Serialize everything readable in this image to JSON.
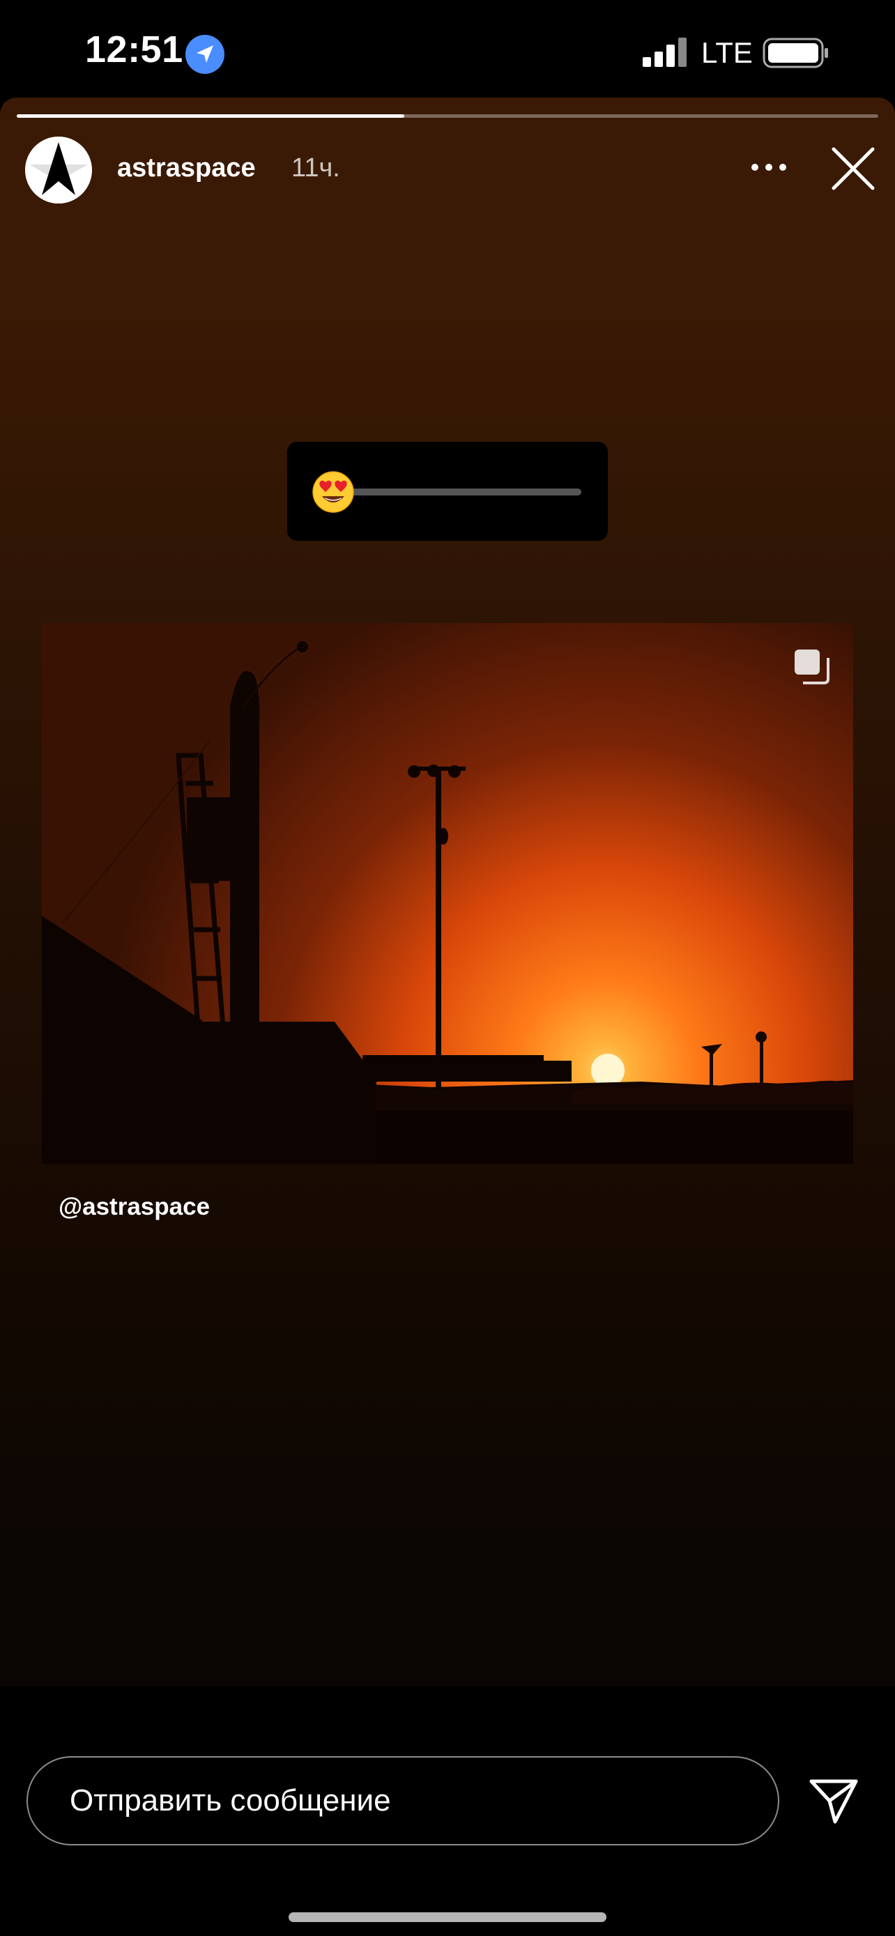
{
  "status_bar": {
    "time": "12:51",
    "network": "LTE",
    "icons": [
      "location-arrow-icon",
      "cellular-signal-icon",
      "battery-icon"
    ]
  },
  "story": {
    "progress": 0.45,
    "username": "astraspace",
    "post_age": "11ч.",
    "mention": "@astraspace",
    "slider_emoji": "😍",
    "slider_value": 0.0,
    "icons": [
      "more-options-icon",
      "close-icon",
      "gallery-stack-icon"
    ]
  },
  "reply": {
    "placeholder": "Отправить сообщение",
    "send_icon": "send-paper-plane-icon"
  },
  "colors": {
    "story_bg_top": "#3a1a04",
    "story_bg_bottom": "#0a0502",
    "sky_glow": "#ff6a10",
    "accent_location": "#4a8dff"
  }
}
